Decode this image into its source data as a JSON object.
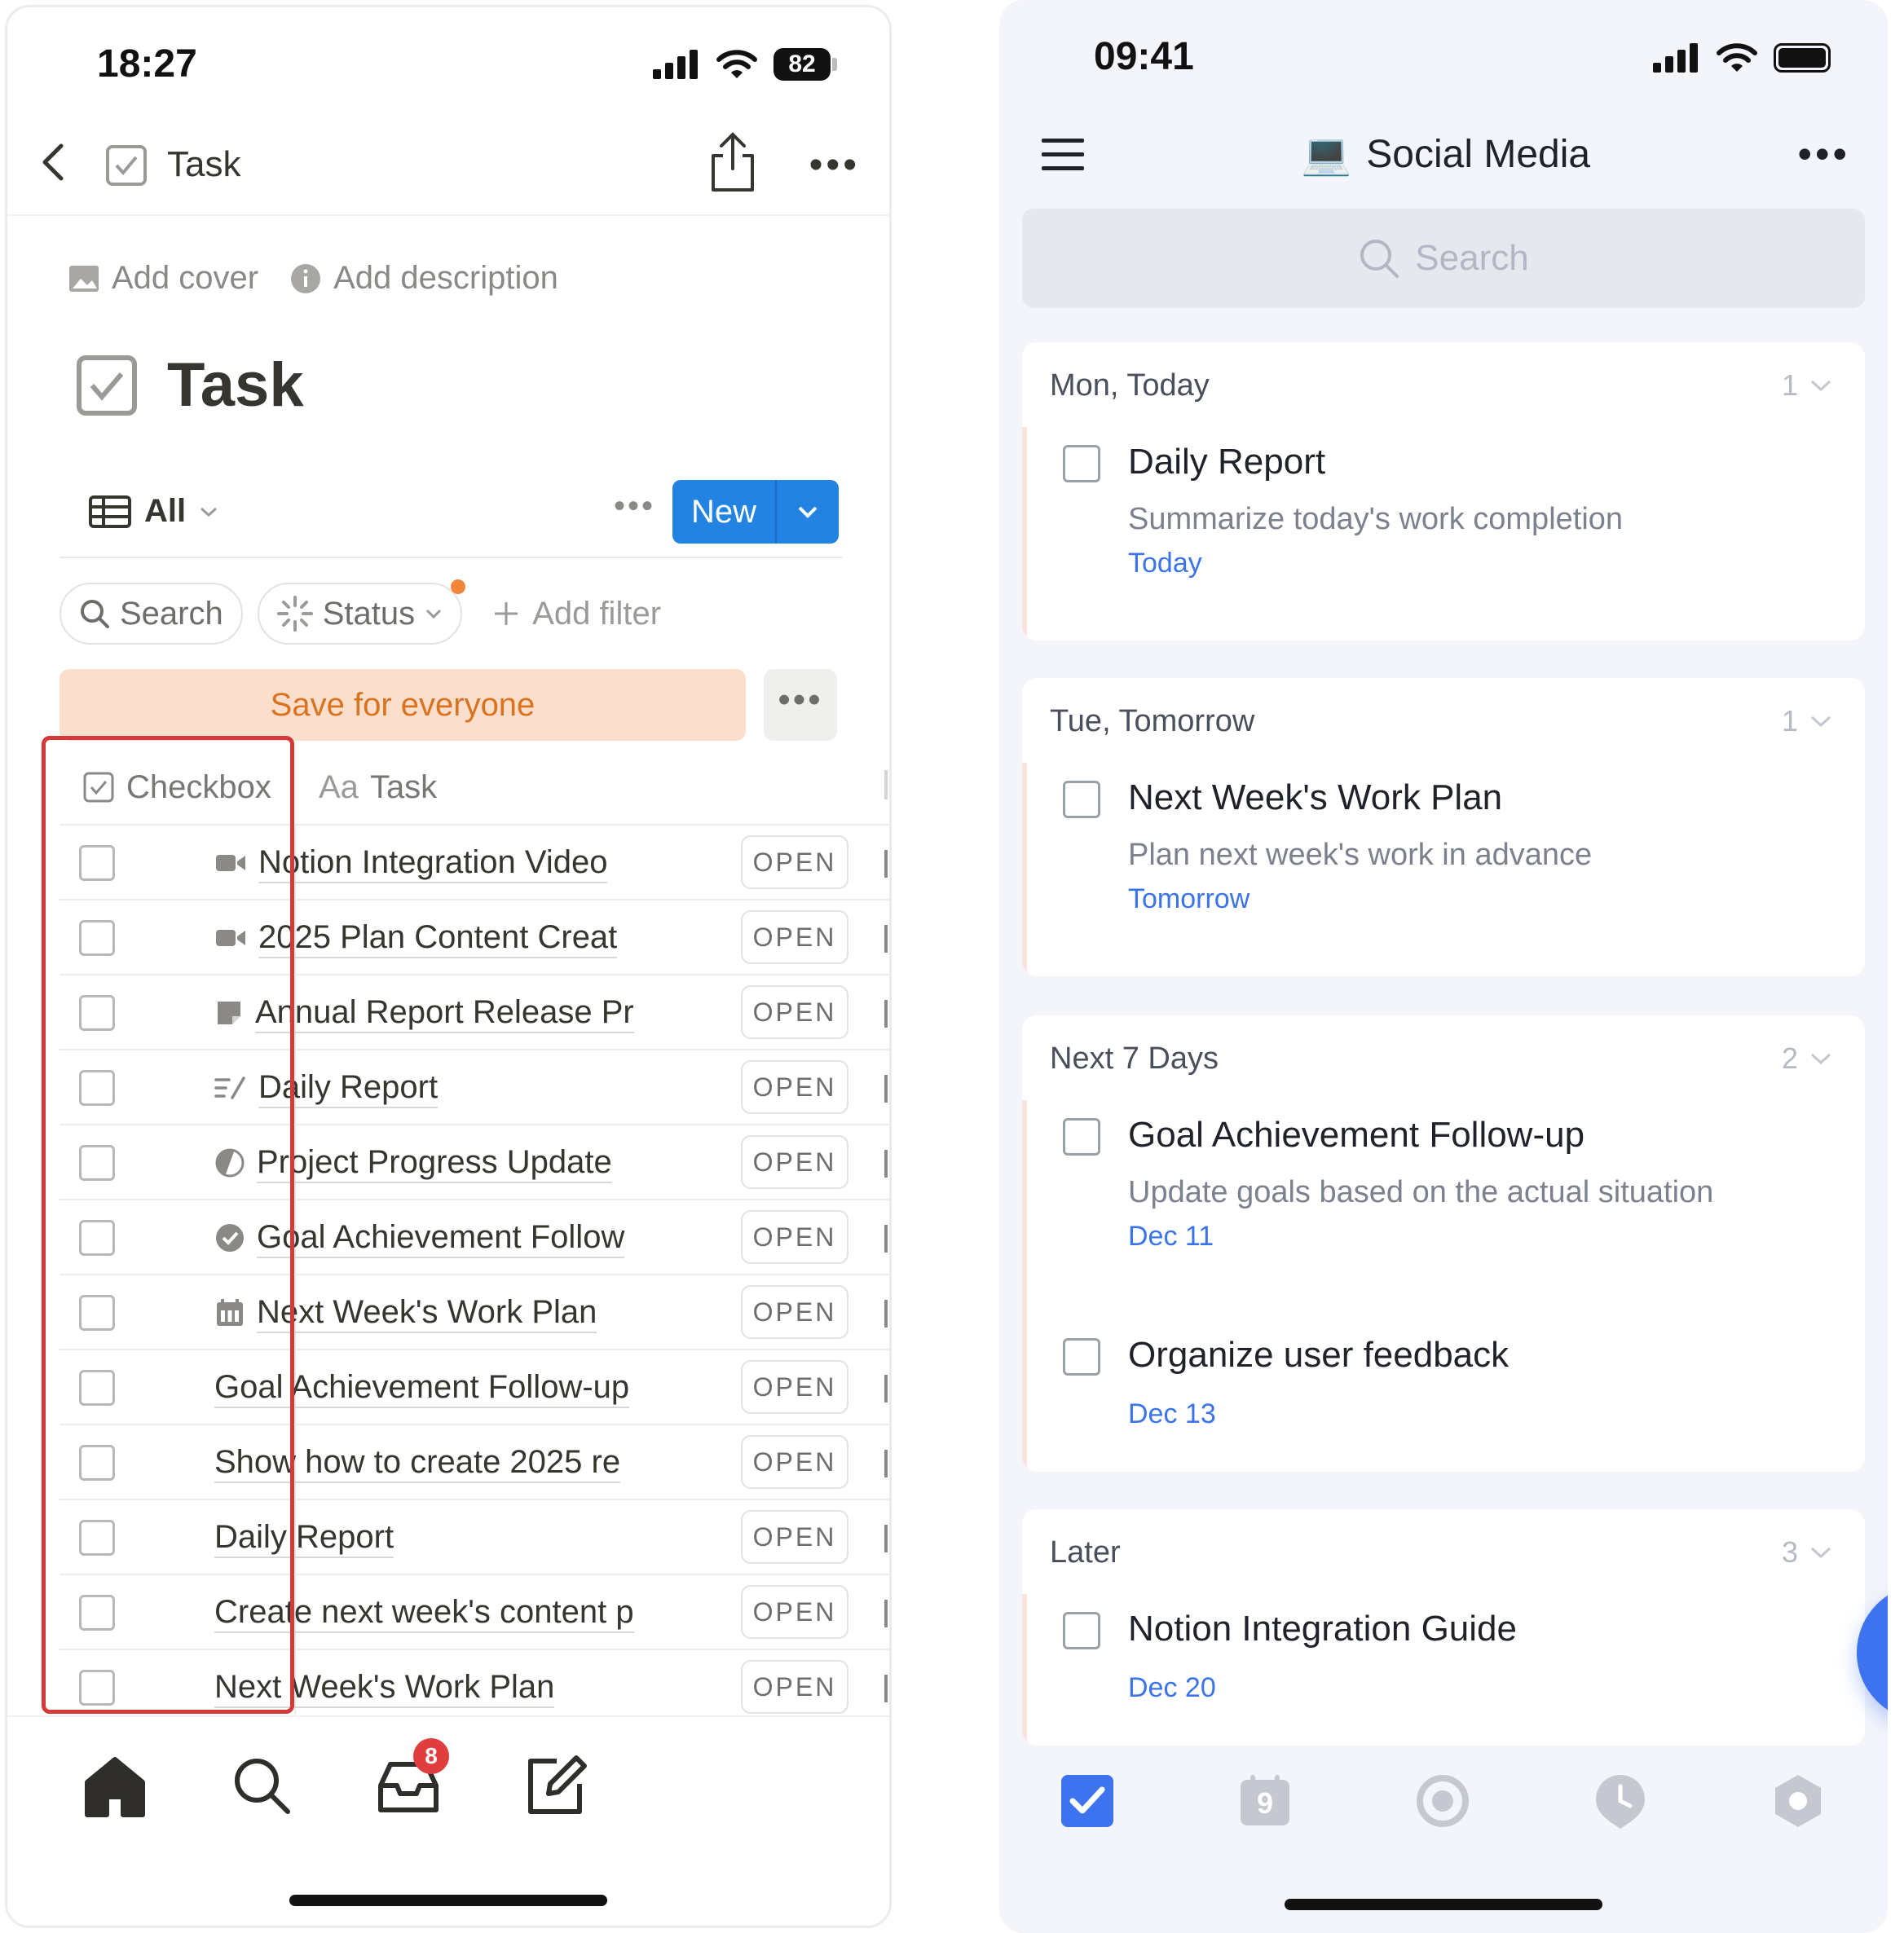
{
  "left": {
    "status": {
      "time": "18:27",
      "battery": "82"
    },
    "nav": {
      "title": "Task"
    },
    "page_links": {
      "add_cover": "Add cover",
      "add_description": "Add description"
    },
    "page_title": "Task",
    "view": {
      "name": "All",
      "new_label": "New"
    },
    "filters": {
      "search": "Search",
      "status": "Status",
      "add_filter": "Add filter"
    },
    "save_label": "Save for everyone",
    "table": {
      "col_checkbox": "Checkbox",
      "col_task_prefix": "Aa",
      "col_task": "Task",
      "open_label": "OPEN",
      "rows": [
        {
          "name": "Notion Integration Video",
          "icon": "video-icon"
        },
        {
          "name": "2025 Plan Content Creat",
          "icon": "video-icon"
        },
        {
          "name": "Annual Report Release Pr",
          "icon": "note-icon"
        },
        {
          "name": "Daily Report",
          "icon": "edit-list-icon"
        },
        {
          "name": "Project Progress Update",
          "icon": "progress-icon"
        },
        {
          "name": "Goal Achievement Follow",
          "icon": "check-circle-icon"
        },
        {
          "name": "Next Week's Work Plan",
          "icon": "calendar-icon"
        },
        {
          "name": "Goal Achievement Follow-up",
          "icon": ""
        },
        {
          "name": "Show how to create 2025 re",
          "icon": ""
        },
        {
          "name": "Daily Report",
          "icon": ""
        },
        {
          "name": "Create next week's content p",
          "icon": ""
        },
        {
          "name": "Next Week's Work Plan",
          "icon": ""
        }
      ]
    },
    "tabbar": {
      "inbox_badge": "8"
    }
  },
  "right": {
    "status": {
      "time": "09:41"
    },
    "header": {
      "title": "Social Media",
      "emoji": "💻"
    },
    "search_placeholder": "Search",
    "sections": [
      {
        "title": "Mon, Today",
        "count": "1",
        "tasks": [
          {
            "title": "Daily Report",
            "desc": "Summarize today's work completion",
            "date": "Today"
          }
        ]
      },
      {
        "title": "Tue, Tomorrow",
        "count": "1",
        "tasks": [
          {
            "title": "Next Week's Work Plan",
            "desc": "Plan next week's work in advance",
            "date": "Tomorrow"
          }
        ]
      },
      {
        "title": "Next 7 Days",
        "count": "2",
        "tasks": [
          {
            "title": "Goal Achievement Follow-up",
            "desc": "Update goals based on the actual situation",
            "date": "Dec 11"
          },
          {
            "title": "Organize user feedback",
            "desc": "",
            "date": "Dec 13"
          }
        ]
      },
      {
        "title": "Later",
        "count": "3",
        "tasks": [
          {
            "title": "Notion Integration Guide",
            "desc": "",
            "date": "Dec 20"
          }
        ]
      }
    ],
    "tabbar": {
      "calendar_day": "9"
    },
    "colors": {
      "accent": "#3e73f0",
      "date": "#3b73e8"
    }
  }
}
